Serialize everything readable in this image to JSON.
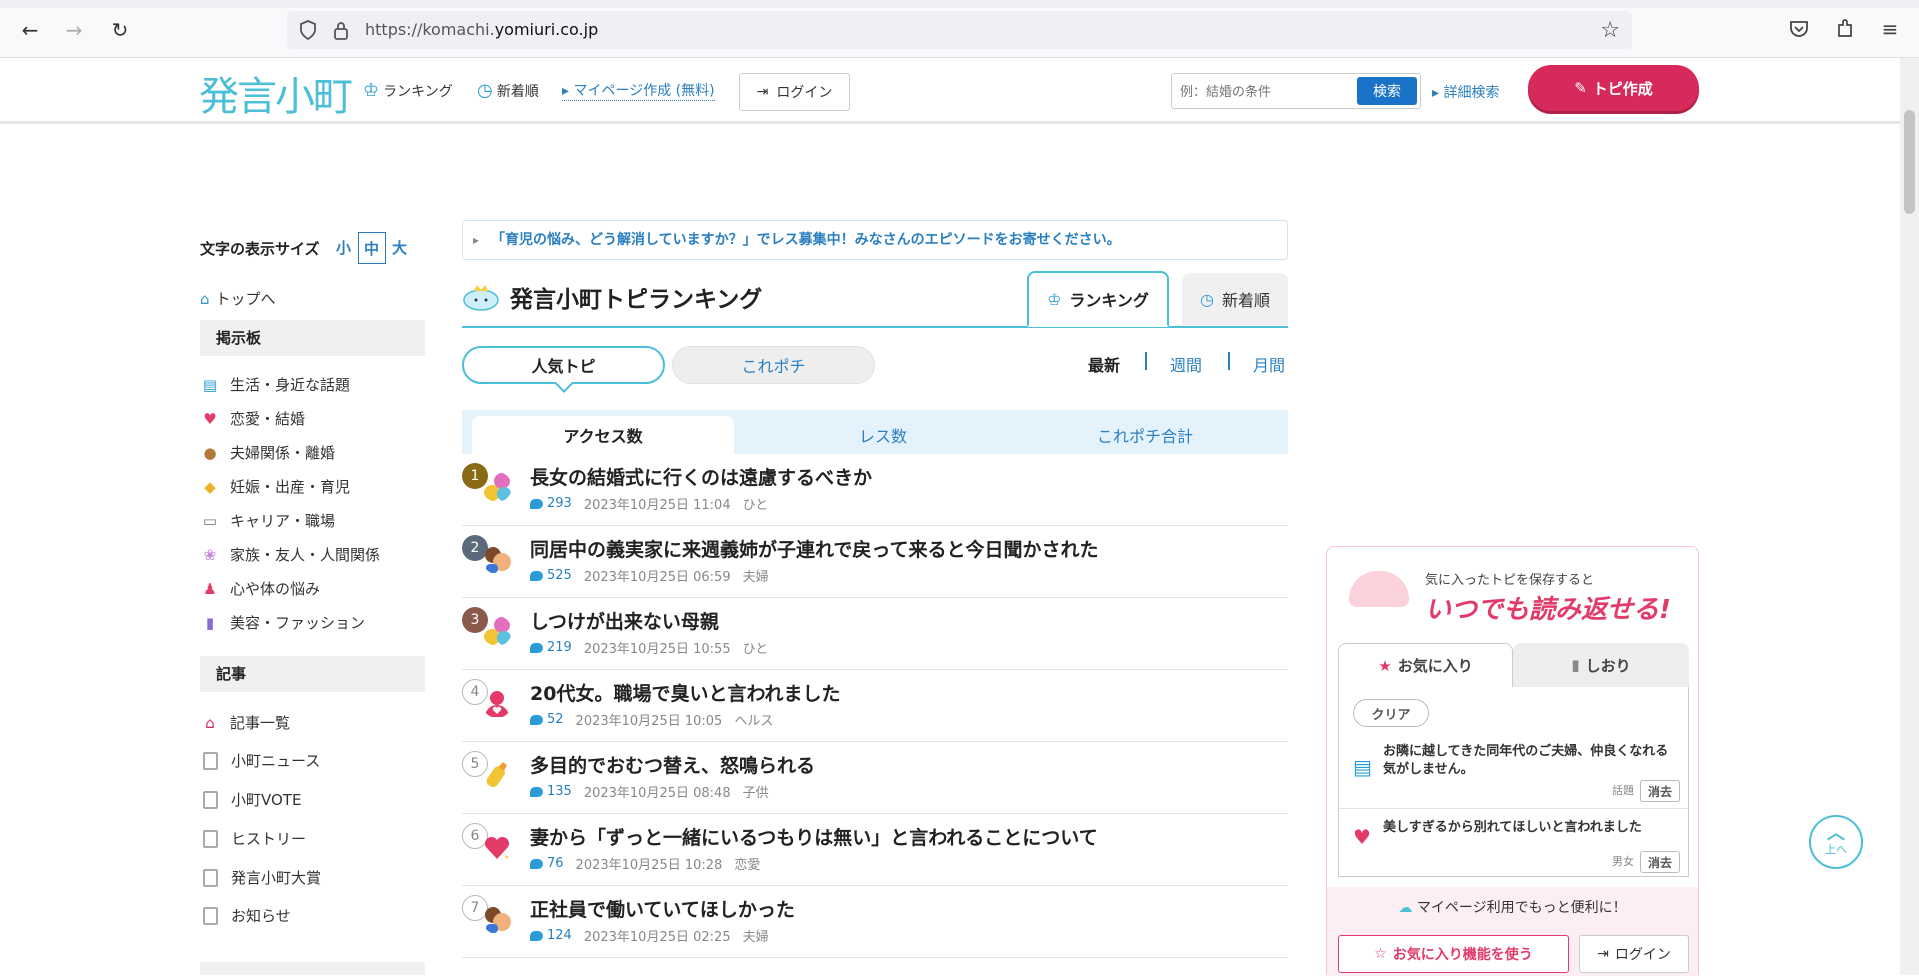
{
  "browser": {
    "url_prefix": "https://komachi.",
    "url_domain": "yomiuri.co.jp"
  },
  "header": {
    "logo": "発言小町",
    "nav_ranking": "ランキング",
    "nav_new": "新着順",
    "mypage": "マイページ作成 (無料)",
    "login": "ログイン",
    "search_placeholder": "例：結婚の条件",
    "search_button": "検索",
    "advanced_search": "詳細検索",
    "create_topic": "トピ作成"
  },
  "sidebar": {
    "fontsize_label": "文字の表示サイズ",
    "sizes": [
      "小",
      "中",
      "大"
    ],
    "top_link": "トップへ",
    "board_heading": "掲示板",
    "board_items": [
      "生活・身近な話題",
      "恋愛・結婚",
      "夫婦関係・離婚",
      "妊娠・出産・育児",
      "キャリア・職場",
      "家族・友人・人間関係",
      "心や体の悩み",
      "美容・ファッション"
    ],
    "article_heading": "記事",
    "article_items": [
      "記事一覧",
      "小町ニュース",
      "小町VOTE",
      "ヒストリー",
      "発言小町大賞",
      "お知らせ"
    ]
  },
  "main": {
    "notice": "「育児の悩み、どう解消していますか？」でレス募集中！みなさんのエピソードをお寄せください。",
    "title": "発言小町トピランキング",
    "tab_ranking": "ランキング",
    "tab_new": "新着順",
    "pill_popular": "人気トピ",
    "pill_korepochi": "これポチ",
    "period_latest": "最新",
    "period_week": "週間",
    "period_month": "月間",
    "sub_access": "アクセス数",
    "sub_res": "レス数",
    "sub_korepochi": "これポチ合計",
    "topics": [
      {
        "rank": "1",
        "title": "長女の結婚式に行くのは遠慮するべきか",
        "count": "293",
        "date": "2023年10月25日 11:04",
        "cat": "ひと"
      },
      {
        "rank": "2",
        "title": "同居中の義実家に来週義姉が子連れで戻って来ると今日聞かされた",
        "count": "525",
        "date": "2023年10月25日 06:59",
        "cat": "夫婦"
      },
      {
        "rank": "3",
        "title": "しつけが出来ない母親",
        "count": "219",
        "date": "2023年10月25日 10:55",
        "cat": "ひと"
      },
      {
        "rank": "4",
        "title": "20代女。職場で臭いと言われました",
        "count": "52",
        "date": "2023年10月25日 10:05",
        "cat": "ヘルス"
      },
      {
        "rank": "5",
        "title": "多目的でおむつ替え、怒鳴られる",
        "count": "135",
        "date": "2023年10月25日 08:48",
        "cat": "子供"
      },
      {
        "rank": "6",
        "title": "妻から「ずっと一緒にいるつもりは無い」と言われることについて",
        "count": "76",
        "date": "2023年10月25日 10:28",
        "cat": "恋愛"
      },
      {
        "rank": "7",
        "title": "正社員で働いていてほしかった",
        "count": "124",
        "date": "2023年10月25日 02:25",
        "cat": "夫婦"
      }
    ]
  },
  "favorites": {
    "promo_small": "気に入ったトピを保存すると",
    "promo_big": "いつでも読み返せる!",
    "tab_fav": "お気に入り",
    "tab_bookmark": "しおり",
    "clear": "クリア",
    "items": [
      {
        "title": "お隣に越してきた同年代のご夫婦、仲良くなれる気がしません。",
        "cat": "話題",
        "delete": "消去"
      },
      {
        "title": "美しすぎるから別れてほしいと言われました",
        "cat": "男女",
        "delete": "消去"
      }
    ],
    "footer_msg": "マイページ利用でもっと便利に！",
    "use_btn": "お気に入り機能を使う",
    "login_btn": "ログイン"
  },
  "to_top": "上へ"
}
